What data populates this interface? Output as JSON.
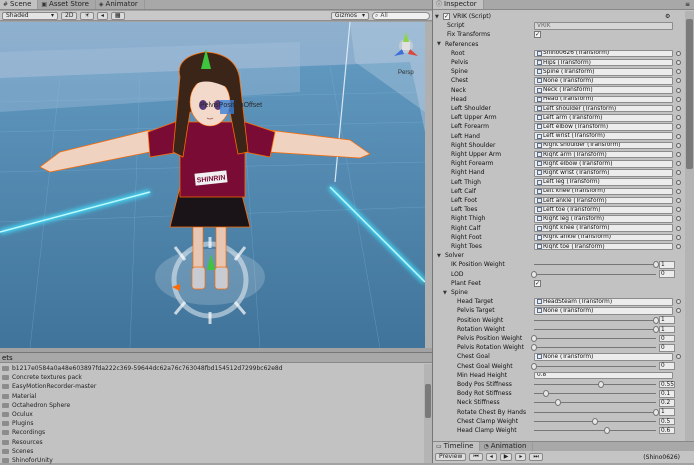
{
  "scene_window": {
    "tabs": [
      {
        "label": "Scene",
        "icon": "scene-icon",
        "active": true
      },
      {
        "label": "Asset Store",
        "icon": "store-icon",
        "active": false
      },
      {
        "label": "Animator",
        "icon": "animator-icon",
        "active": false
      }
    ],
    "shading_mode": "Shaded",
    "mode_2d": "2D",
    "gizmos_label": "Gizmos",
    "search_placeholder": "All",
    "persp_label": "Persp",
    "object_label": "PelvisPositionOffset",
    "shirt_text": "SHINRIN"
  },
  "project_window": {
    "header_label": "ets",
    "items": [
      "b1217e0584a0a48e603897fda222c369-59644dc62a76c763048fbd154512d7299bc62e8d",
      "Concrete textures pack",
      "EasyMotionRecorder-master",
      "Material",
      "Octahedron Sphere",
      "Oculux",
      "Plugins",
      "Recordings",
      "Resources",
      "Scenes",
      "ShinoforUnity"
    ]
  },
  "inspector": {
    "tab_label": "Inspector",
    "component_title": "VRIK (Script)",
    "script_label": "Script",
    "script_value": "VRIK",
    "fix_transforms_label": "Fix Transforms",
    "fix_transforms_checked": true,
    "references_label": "References",
    "references": [
      {
        "label": "Root",
        "value": "Shino0626 (Transform)"
      },
      {
        "label": "Pelvis",
        "value": "Hips (Transform)"
      },
      {
        "label": "Spine",
        "value": "Spine (Transform)"
      },
      {
        "label": "Chest",
        "value": "None (Transform)"
      },
      {
        "label": "Neck",
        "value": "Neck (Transform)"
      },
      {
        "label": "Head",
        "value": "Head (Transform)"
      },
      {
        "label": "Left Shoulder",
        "value": "Left shoulder (Transform)"
      },
      {
        "label": "Left Upper Arm",
        "value": "Left arm (Transform)"
      },
      {
        "label": "Left Forearm",
        "value": "Left elbow (Transform)"
      },
      {
        "label": "Left Hand",
        "value": "Left wrist (Transform)"
      },
      {
        "label": "Right Shoulder",
        "value": "Right shoulder (Transform)"
      },
      {
        "label": "Right Upper Arm",
        "value": "Right arm (Transform)"
      },
      {
        "label": "Right Forearm",
        "value": "Right elbow (Transform)"
      },
      {
        "label": "Right Hand",
        "value": "Right wrist (Transform)"
      },
      {
        "label": "Left Thigh",
        "value": "Left leg (Transform)"
      },
      {
        "label": "Left Calf",
        "value": "Left knee (Transform)"
      },
      {
        "label": "Left Foot",
        "value": "Left ankle (Transform)"
      },
      {
        "label": "Left Toes",
        "value": "Left toe (Transform)"
      },
      {
        "label": "Right Thigh",
        "value": "Right leg (Transform)"
      },
      {
        "label": "Right Calf",
        "value": "Right knee (Transform)"
      },
      {
        "label": "Right Foot",
        "value": "Right ankle (Transform)"
      },
      {
        "label": "Right Toes",
        "value": "Right toe (Transform)"
      }
    ],
    "solver_label": "Solver",
    "ik_position_weight_label": "IK Position Weight",
    "ik_position_weight": "1",
    "ik_position_weight_fraction": 1.0,
    "lod_label": "LOD",
    "lod_value": "0",
    "lod_fraction": 0.0,
    "plant_feet_label": "Plant Feet",
    "plant_feet_checked": true,
    "spine_label": "Spine",
    "spine_rows": [
      {
        "label": "Head Target",
        "kind": "object",
        "value": "HeadSteam (Transform)"
      },
      {
        "label": "Pelvis Target",
        "kind": "object",
        "value": "None (Transform)"
      },
      {
        "label": "Position Weight",
        "kind": "slider",
        "value": "1",
        "fraction": 1.0
      },
      {
        "label": "Rotation Weight",
        "kind": "slider",
        "value": "1",
        "fraction": 1.0
      },
      {
        "label": "Pelvis Position Weight",
        "kind": "slider",
        "value": "0",
        "fraction": 0.0
      },
      {
        "label": "Pelvis Rotation Weight",
        "kind": "slider",
        "value": "0",
        "fraction": 0.0
      },
      {
        "label": "Chest Goal",
        "kind": "object",
        "value": "None (Transform)"
      },
      {
        "label": "Chest Goal Weight",
        "kind": "slider",
        "value": "0",
        "fraction": 0.0
      },
      {
        "label": "Min Head Height",
        "kind": "number",
        "value": "0.8"
      },
      {
        "label": "Body Pos Stiffness",
        "kind": "slider",
        "value": "0.55",
        "fraction": 0.55
      },
      {
        "label": "Body Rot Stiffness",
        "kind": "slider",
        "value": "0.1",
        "fraction": 0.1
      },
      {
        "label": "Neck Stiffness",
        "kind": "slider",
        "value": "0.2",
        "fraction": 0.2
      },
      {
        "label": "Rotate Chest By Hands",
        "kind": "slider",
        "value": "1",
        "fraction": 1.0
      },
      {
        "label": "Chest Clamp Weight",
        "kind": "slider",
        "value": "0.5",
        "fraction": 0.5
      },
      {
        "label": "Head Clamp Weight",
        "kind": "slider",
        "value": "0.6",
        "fraction": 0.6
      }
    ]
  },
  "timeline": {
    "tabs": [
      {
        "label": "Timeline",
        "icon": "timeline-icon",
        "active": true
      },
      {
        "label": "Animation",
        "icon": "animation-icon",
        "active": false
      }
    ],
    "preview_label": "Preview",
    "track_label": "(Shino0626)"
  },
  "colors": {
    "sky": "#8aa8c6",
    "floor": "#4d84aa",
    "glow": "#3fe4ff",
    "shirt": "#7a0b35",
    "hair": "#3b2418",
    "selection_outline": "#ff6a00"
  }
}
